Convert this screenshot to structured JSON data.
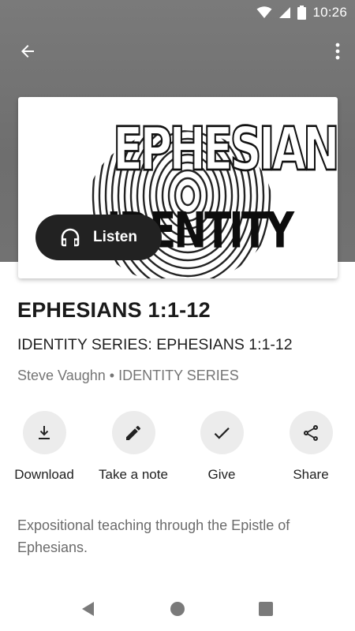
{
  "status_bar": {
    "time": "10:26",
    "icons": [
      "wifi-icon",
      "cell-signal-icon",
      "battery-icon"
    ]
  },
  "app_bar": {
    "back_icon": "arrow-left-icon",
    "menu_icon": "more-vert-icon"
  },
  "artwork": {
    "title_text": "EPHESIANS",
    "subtitle_text": "IDENTITY"
  },
  "listen_button": {
    "icon": "headphones-icon",
    "label": "Listen"
  },
  "sermon": {
    "title": "EPHESIANS 1:1-12",
    "subtitle": "IDENTITY SERIES: EPHESIANS 1:1-12",
    "speaker": "Steve Vaughn",
    "separator": "•",
    "series": "IDENTITY SERIES",
    "description": "Expositional teaching through the Epistle of Ephesians."
  },
  "actions": [
    {
      "label": "Download",
      "icon": "download-icon"
    },
    {
      "label": "Take a note",
      "icon": "pencil-icon"
    },
    {
      "label": "Give",
      "icon": "check-icon"
    },
    {
      "label": "Share",
      "icon": "share-icon"
    }
  ],
  "nav_bar": {
    "icons": [
      "back-triangle-icon",
      "home-circle-icon",
      "recents-square-icon"
    ]
  },
  "colors": {
    "header_grey": "#737373",
    "listen_button": "#222222",
    "action_circle": "#ececec",
    "text_primary": "#1a1a1a",
    "text_secondary": "#757575"
  }
}
